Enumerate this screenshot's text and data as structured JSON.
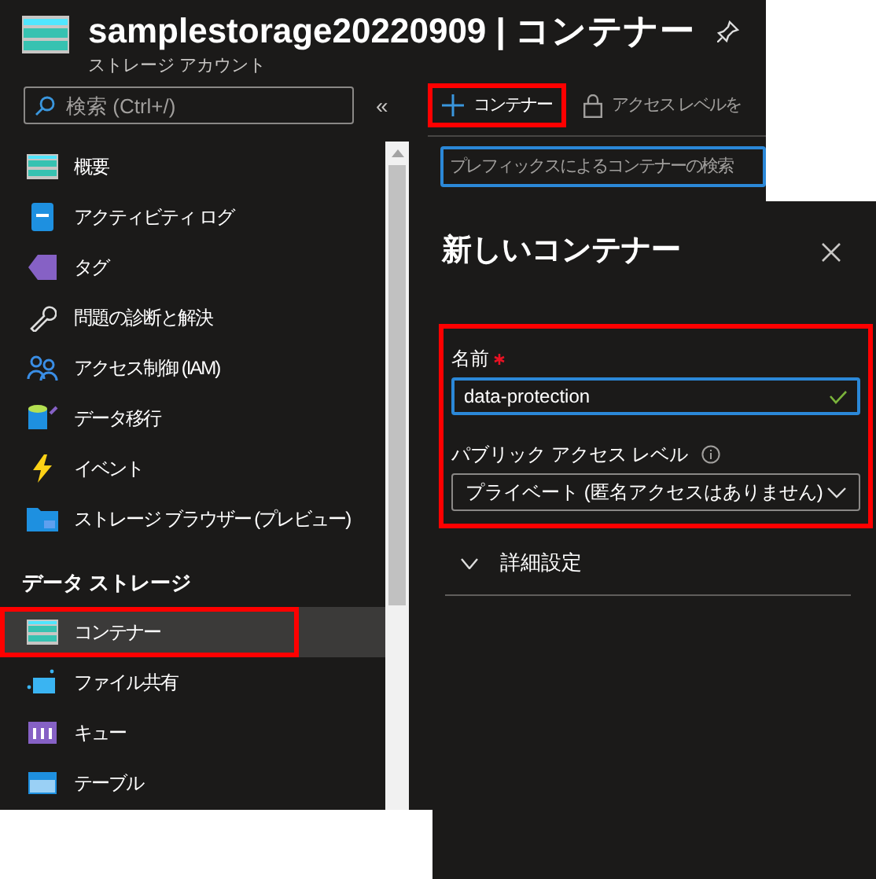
{
  "header": {
    "title": "samplestorage20220909 | コンテナー",
    "subtitle": "ストレージ アカウント"
  },
  "sidebar": {
    "search": {
      "placeholder": "検索 (Ctrl+/)"
    },
    "collapse": "«",
    "items": [
      {
        "kind": "item",
        "label": "概要",
        "selected": false,
        "highlighted": false
      },
      {
        "kind": "item",
        "label": "アクティビティ ログ",
        "selected": false,
        "highlighted": false
      },
      {
        "kind": "item",
        "label": "タグ",
        "selected": false,
        "highlighted": false
      },
      {
        "kind": "item",
        "label": "問題の診断と解決",
        "selected": false,
        "highlighted": false
      },
      {
        "kind": "item",
        "label": "アクセス制御 (IAM)",
        "selected": false,
        "highlighted": false
      },
      {
        "kind": "item",
        "label": "データ移行",
        "selected": false,
        "highlighted": false
      },
      {
        "kind": "item",
        "label": "イベント",
        "selected": false,
        "highlighted": false
      },
      {
        "kind": "item",
        "label": "ストレージ ブラウザー (プレビュー)",
        "selected": false,
        "highlighted": false
      },
      {
        "kind": "section",
        "label": "データ ストレージ"
      },
      {
        "kind": "item",
        "label": "コンテナー",
        "selected": true,
        "highlighted": true
      },
      {
        "kind": "item",
        "label": "ファイル共有",
        "selected": false,
        "highlighted": false
      },
      {
        "kind": "item",
        "label": "キュー",
        "selected": false,
        "highlighted": false
      },
      {
        "kind": "item",
        "label": "テーブル",
        "selected": false,
        "highlighted": false
      }
    ]
  },
  "toolbar": [
    {
      "kind": "add",
      "label": "コンテナー",
      "highlighted": true
    },
    {
      "kind": "lock",
      "label": "アクセス レベルを",
      "highlighted": false
    }
  ],
  "container_search": {
    "placeholder": "プレフィックスによるコンテナーの検索"
  },
  "panel": {
    "title": "新しいコンテナー",
    "form_highlighted": true,
    "name_field": {
      "label": "名前",
      "required": true,
      "value": "data-protection",
      "valid": true
    },
    "access_level": {
      "label": "パブリック アクセス レベル",
      "value": "プライベート (匿名アクセスはありません)"
    },
    "advanced": {
      "label": "詳細設定",
      "expanded": false
    }
  }
}
